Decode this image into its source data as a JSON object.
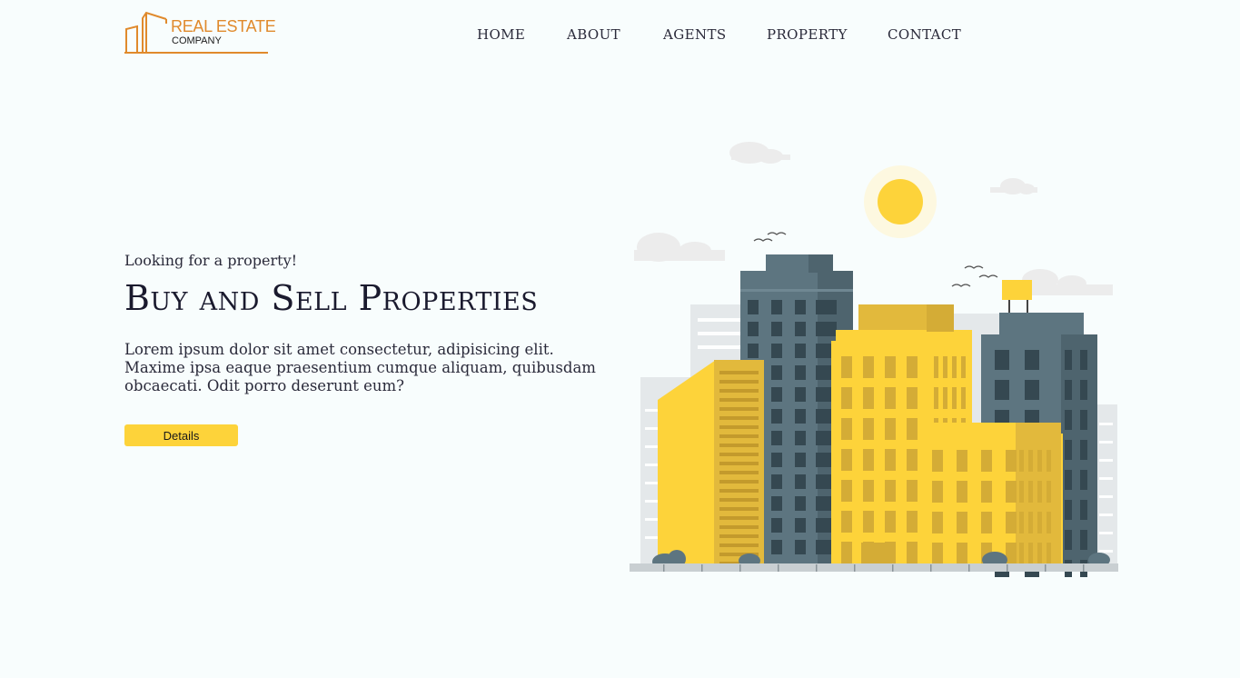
{
  "logo": {
    "line1": "REAL ESTATE",
    "line2": "COMPANY",
    "color": "#e08a2c"
  },
  "nav": {
    "items": [
      "HOME",
      "ABOUT",
      "AGENTS",
      "PROPERTY",
      "CONTACT"
    ]
  },
  "hero": {
    "subtitle": "Looking for a property!",
    "title": "Buy and Sell Properties",
    "description": "Lorem ipsum dolor sit amet consectetur, adipisicing elit. Maxime ipsa eaque praesentium cumque aliquam, quibusdam obcaecati. Odit porro deserunt eum?",
    "button_label": "Details",
    "button_color": "#fdd33a"
  },
  "illustration": {
    "name": "city-buildings-illustration",
    "colors": {
      "yellow": "#fdd33a",
      "slate": "#5d7580",
      "sun": "#fdd33a"
    }
  }
}
